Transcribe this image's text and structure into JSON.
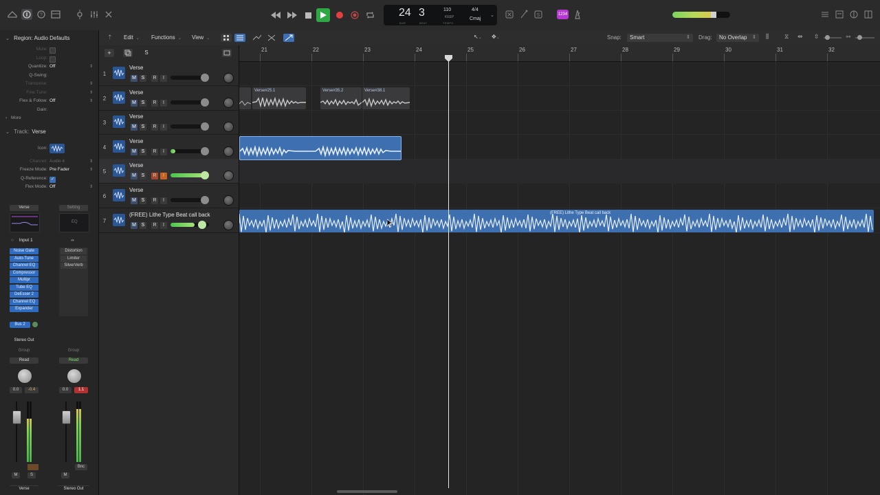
{
  "transport": {
    "bar": "24",
    "beat": "3",
    "bar_caption": "BAR",
    "beat_caption": "BEAT",
    "tempo": "110",
    "tempo_sub": "KEEP",
    "tempo_caption": "TEMPO",
    "timesig": "4/4",
    "key": "Cmaj",
    "badge": "1234"
  },
  "inspector": {
    "region_header": "Region: Audio Defaults",
    "region_rows": [
      {
        "label": "Mute:",
        "value": "",
        "type": "check",
        "dim": true
      },
      {
        "label": "Loop:",
        "value": "",
        "type": "check",
        "dim": true
      },
      {
        "label": "Quantize:",
        "value": "Off",
        "type": "select",
        "dim": false
      },
      {
        "label": "Q-Swing:",
        "value": "",
        "type": "text",
        "dim": false
      },
      {
        "label": "Transpose:",
        "value": "",
        "type": "select",
        "dim": true
      },
      {
        "label": "Fine Tune:",
        "value": "",
        "type": "select",
        "dim": true
      },
      {
        "label": "Flex & Follow:",
        "value": "Off",
        "type": "select",
        "dim": false
      },
      {
        "label": "Gain:",
        "value": "",
        "type": "text",
        "dim": false
      }
    ],
    "more_label": "More",
    "track_header_label": "Track:",
    "track_header_name": "Verse",
    "track_rows": [
      {
        "label": "Icon:",
        "value": "",
        "type": "icon"
      },
      {
        "label": "Channel:",
        "value": "Audio 4",
        "type": "select",
        "dim": true
      },
      {
        "label": "Freeze Mode:",
        "value": "Pre Fader",
        "type": "select"
      },
      {
        "label": "Q-Reference:",
        "value": "✓",
        "type": "check"
      },
      {
        "label": "Flex Mode:",
        "value": "Off",
        "type": "select"
      }
    ],
    "strip1": {
      "name": "Verse",
      "input": "Input 1",
      "plugins": [
        "Noise Gate",
        "Auto-Tune",
        "Channel EQ",
        "Compressor",
        "Multipr",
        "Tube EQ",
        "DeEsser 2",
        "Channel EQ",
        "Expander"
      ],
      "send": "Bus 2",
      "output": "Stereo Out",
      "group": "Group",
      "automation": "Read",
      "vol_value": "0.0",
      "peak_value": "-0.4",
      "bottom_name": "Verse",
      "m": "M",
      "s": "S"
    },
    "strip2": {
      "setting": "Setting",
      "eq": "EQ",
      "plugins": [
        "Distortion",
        "Limiter",
        "SilverVerb"
      ],
      "group": "Group",
      "automation": "Read",
      "vol_value": "0.0",
      "peak_value": "1.1",
      "bnc": "Bnc",
      "bottom_name": "Stereo Out",
      "m": "M"
    }
  },
  "editbar": {
    "edit": "Edit",
    "functions": "Functions",
    "view": "View",
    "snap_label": "Snap:",
    "snap_value": "Smart",
    "drag_label": "Drag:",
    "drag_value": "No Overlap"
  },
  "track_header_tools": {
    "add": "+",
    "solo_all": "S"
  },
  "tracks": [
    {
      "num": "1",
      "name": "Verse",
      "vol": 0.88,
      "green": false,
      "mute": "M",
      "solo": "S",
      "rec": "R",
      "input": "I"
    },
    {
      "num": "2",
      "name": "Verse",
      "vol": 0.88,
      "green": false,
      "mute": "M",
      "solo": "S",
      "rec": "R",
      "input": "I"
    },
    {
      "num": "3",
      "name": "Verse",
      "vol": 0.88,
      "green": false,
      "mute": "M",
      "solo": "S",
      "rec": "R",
      "input": "I"
    },
    {
      "num": "4",
      "name": "Verse",
      "vol": 0.88,
      "green": true,
      "mute": "M",
      "solo": "S",
      "rec": "R",
      "input": "I"
    },
    {
      "num": "5",
      "name": "Verse",
      "vol": 0.88,
      "green": true,
      "mute": "M",
      "solo": "S",
      "rec": "R",
      "input": "I"
    },
    {
      "num": "6",
      "name": "Verse",
      "vol": 0.88,
      "green": false,
      "mute": "M",
      "solo": "S",
      "rec": "R",
      "input": "I"
    },
    {
      "num": "7",
      "name": "(FREE) Lithe Type Beat call back",
      "vol": 0.75,
      "green": true,
      "mute": "M",
      "solo": "S",
      "rec": "R",
      "input": "I"
    }
  ],
  "ruler": {
    "bars": [
      "21",
      "22",
      "23",
      "24",
      "25",
      "26",
      "27",
      "28",
      "29",
      "30",
      "31",
      "32"
    ]
  },
  "regions": {
    "r1_label": "Verse#25.1",
    "r2_label": "Verse#35.2",
    "r3_label": "Verse#38.1",
    "r7_label": "(FREE) Lithe Type Beat call back"
  },
  "colors": {
    "region_blue": "#3e6fae",
    "region_gray": "#3a3a3c",
    "accent_green": "#4cc34f",
    "record_red": "#e24040"
  }
}
